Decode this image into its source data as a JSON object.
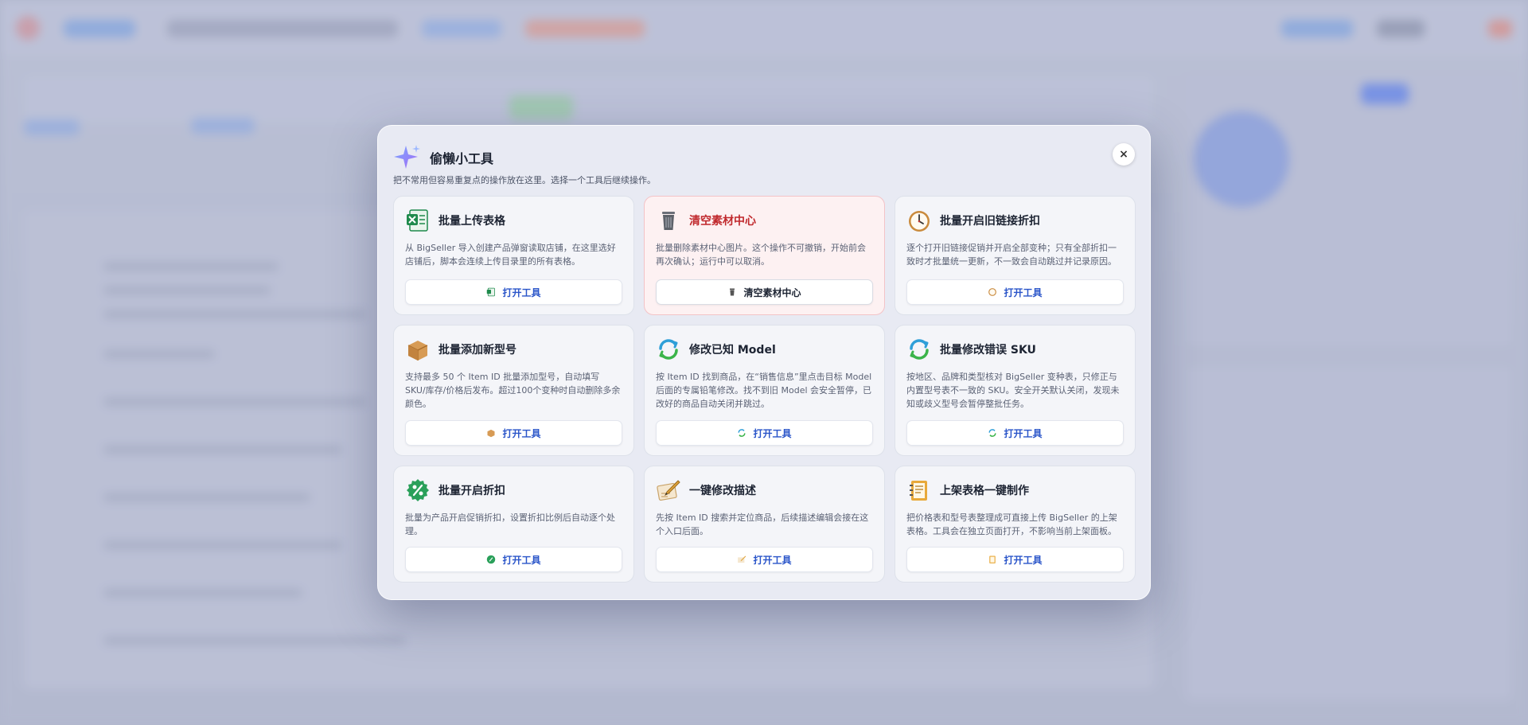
{
  "modal": {
    "title": "偷懒小工具",
    "description": "把不常用但容易重复点的操作放在这里。选择一个工具后继续操作。",
    "close_label": "×",
    "icon": "sparkle-icon",
    "accent_color": "#2a55c9",
    "danger_color": "#c0282c"
  },
  "tools": [
    {
      "icon": "excel-icon",
      "title": "批量上传表格",
      "description": "从 BigSeller 导入创建产品弹窗读取店铺，在这里选好店铺后，脚本会连续上传目录里的所有表格。",
      "button": "打开工具"
    },
    {
      "icon": "trash-icon",
      "title": "清空素材中心",
      "description": "批量删除素材中心图片。这个操作不可撤销，开始前会再次确认；运行中可以取消。",
      "button": "清空素材中心",
      "danger": true
    },
    {
      "icon": "clock-icon",
      "title": "批量开启旧链接折扣",
      "description": "逐个打开旧链接促销并开启全部变种；只有全部折扣一致时才批量统一更新，不一致会自动跳过并记录原因。",
      "button": "打开工具"
    },
    {
      "icon": "box-icon",
      "title": "批量添加新型号",
      "description": "支持最多 50 个 Item ID 批量添加型号，自动填写 SKU/库存/价格后发布。超过100个变种时自动删除多余颜色。",
      "button": "打开工具"
    },
    {
      "icon": "refresh-icon",
      "title": "修改已知 Model",
      "description": "按 Item ID 找到商品，在“销售信息”里点击目标 Model 后面的专属铅笔修改。找不到旧 Model 会安全暂停，已改好的商品自动关闭并跳过。",
      "button": "打开工具"
    },
    {
      "icon": "refresh-icon",
      "title": "批量修改错误 SKU",
      "description": "按地区、品牌和类型核对 BigSeller 变种表，只修正与内置型号表不一致的 SKU。安全开关默认关闭，发现未知或歧义型号会暂停整批任务。",
      "button": "打开工具"
    },
    {
      "icon": "percent-icon",
      "title": "批量开启折扣",
      "description": "批量为产品开启促销折扣，设置折扣比例后自动逐个处理。",
      "button": "打开工具"
    },
    {
      "icon": "pen-icon",
      "title": "一键修改描述",
      "description": "先按 Item ID 搜索并定位商品，后续描述编辑会接在这个入口后面。",
      "button": "打开工具"
    },
    {
      "icon": "notebook-icon",
      "title": "上架表格一键制作",
      "description": "把价格表和型号表整理成可直接上传 BigSeller 的上架表格。工具会在独立页面打开，不影响当前上架面板。",
      "button": "打开工具"
    }
  ]
}
